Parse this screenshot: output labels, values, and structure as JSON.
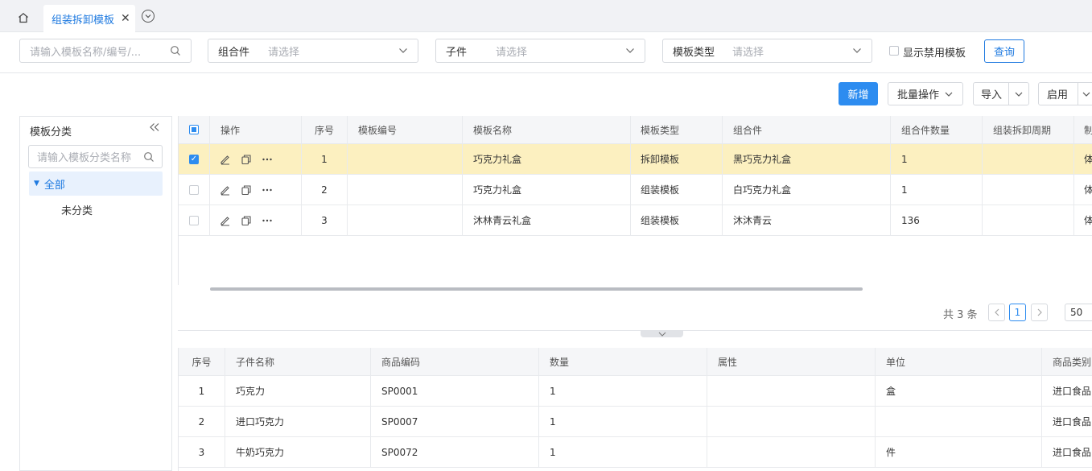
{
  "tabs": {
    "home_icon": "home-icon",
    "active_tab": "组装拆卸模板",
    "close_glyph": "✕"
  },
  "filters": {
    "search_placeholder": "请输入模板名称/编号/...",
    "assembly_label": "组合件",
    "assembly_placeholder": "请选择",
    "child_label": "子件",
    "child_placeholder": "请选择",
    "type_label": "模板类型",
    "type_placeholder": "请选择",
    "show_disabled_label": "显示禁用模板",
    "query_label": "查询"
  },
  "toolbar": {
    "add_label": "新增",
    "batch_label": "批量操作",
    "import_label": "导入",
    "enable_label": "启用"
  },
  "sidebar": {
    "title": "模板分类",
    "search_placeholder": "请输入模板分类名称",
    "tree": [
      {
        "label": "全部"
      },
      {
        "label": "未分类"
      }
    ]
  },
  "main_table": {
    "headers": [
      "操作",
      "序号",
      "模板编号",
      "模板名称",
      "模板类型",
      "组合件",
      "组合件数量",
      "组装拆卸周期",
      "制"
    ],
    "rows": [
      {
        "index": "1",
        "code": "",
        "name": "巧克力礼盒",
        "type": "拆卸模板",
        "assembly": "黑巧克力礼盒",
        "qty": "1",
        "period": "",
        "extra": "体",
        "checked": true
      },
      {
        "index": "2",
        "code": "",
        "name": "巧克力礼盒",
        "type": "组装模板",
        "assembly": "白巧克力礼盒",
        "qty": "1",
        "period": "",
        "extra": "体",
        "checked": false
      },
      {
        "index": "3",
        "code": "",
        "name": "沐林青云礼盒",
        "type": "组装模板",
        "assembly": "沐沐青云",
        "qty": "136",
        "period": "",
        "extra": "体",
        "checked": false
      }
    ]
  },
  "pagination": {
    "total_text": "共 3 条",
    "current_page": "1",
    "page_size": "50"
  },
  "detail_table": {
    "headers": [
      "序号",
      "子件名称",
      "商品编码",
      "数量",
      "属性",
      "单位",
      "商品类别"
    ],
    "rows": [
      {
        "index": "1",
        "name": "巧克力",
        "code": "SP0001",
        "qty": "1",
        "attr": "",
        "unit": "盒",
        "category": "进口食品"
      },
      {
        "index": "2",
        "name": "进口巧克力",
        "code": "SP0007",
        "qty": "1",
        "attr": "",
        "unit": "",
        "category": "进口食品"
      },
      {
        "index": "3",
        "name": "牛奶巧克力",
        "code": "SP0072",
        "qty": "1",
        "attr": "",
        "unit": "件",
        "category": "进口食品"
      }
    ]
  },
  "colors": {
    "accent": "#2d8cf0",
    "selected_row": "#fcf0c0",
    "tab_active_text": "#1f7ae0"
  }
}
